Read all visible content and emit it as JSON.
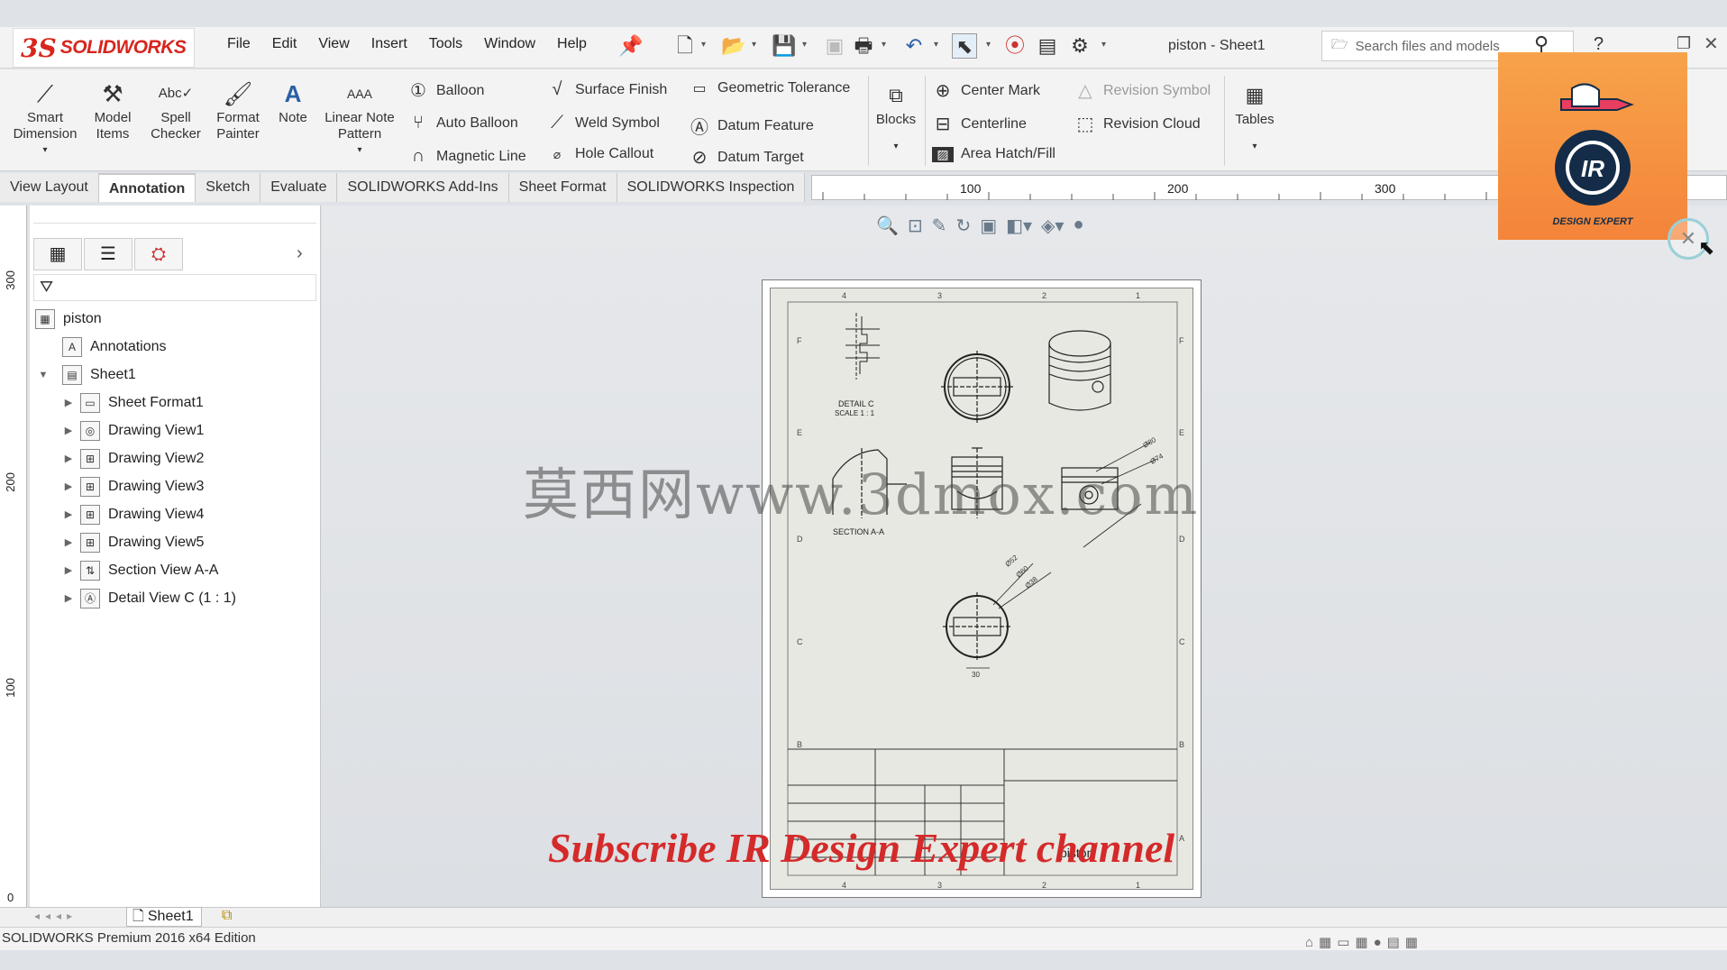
{
  "app": {
    "logo_ds": "3S",
    "logo_text": "SOLIDWORKS",
    "title": "piston - Sheet1",
    "status": "SOLIDWORKS Premium 2016 x64 Edition"
  },
  "menu": [
    "File",
    "Edit",
    "View",
    "Insert",
    "Tools",
    "Window",
    "Help"
  ],
  "search": {
    "placeholder": "Search files and models"
  },
  "ribbon": {
    "big": [
      {
        "label1": "Smart",
        "label2": "Dimension",
        "icon": "smart-dimension-icon"
      },
      {
        "label1": "Model",
        "label2": "Items",
        "icon": "model-items-icon"
      },
      {
        "label1": "Spell",
        "label2": "Checker",
        "icon": "spell-checker-icon"
      },
      {
        "label1": "Format",
        "label2": "Painter",
        "icon": "format-painter-icon"
      },
      {
        "label1": "Note",
        "label2": "",
        "icon": "note-icon"
      },
      {
        "label1": "Linear Note",
        "label2": "Pattern",
        "icon": "linear-note-pattern-icon"
      }
    ],
    "col1": [
      "Balloon",
      "Auto Balloon",
      "Magnetic Line"
    ],
    "col2": [
      "Surface Finish",
      "Weld Symbol",
      "Hole Callout"
    ],
    "col3": [
      "Geometric Tolerance",
      "Datum Feature",
      "Datum Target"
    ],
    "blocks": "Blocks",
    "col4": [
      "Center Mark",
      "Centerline",
      "Area Hatch/Fill"
    ],
    "col5": [
      "Revision Symbol",
      "Revision Cloud"
    ],
    "tables": "Tables"
  },
  "tabs": [
    "View Layout",
    "Annotation",
    "Sketch",
    "Evaluate",
    "SOLIDWORKS Add-Ins",
    "Sheet Format",
    "SOLIDWORKS Inspection"
  ],
  "active_tab": "Annotation",
  "ruler_top": [
    "100",
    "200",
    "300"
  ],
  "ruler_left": [
    "300",
    "200",
    "100",
    "0"
  ],
  "tree": {
    "root": "piston",
    "items": [
      {
        "label": "Annotations",
        "level": 1,
        "icon": "annotations-icon",
        "glyph": "A"
      },
      {
        "label": "Sheet1",
        "level": 1,
        "icon": "sheet-icon",
        "glyph": "▤",
        "expanded": true
      },
      {
        "label": "Sheet Format1",
        "level": 2,
        "icon": "sheet-format-icon",
        "glyph": "▭"
      },
      {
        "label": "Drawing View1",
        "level": 2,
        "icon": "drawing-view-icon",
        "glyph": "◎"
      },
      {
        "label": "Drawing View2",
        "level": 2,
        "icon": "drawing-view-icon",
        "glyph": "⊞"
      },
      {
        "label": "Drawing View3",
        "level": 2,
        "icon": "drawing-view-icon",
        "glyph": "⊞"
      },
      {
        "label": "Drawing View4",
        "level": 2,
        "icon": "drawing-view-icon",
        "glyph": "⊞"
      },
      {
        "label": "Drawing View5",
        "level": 2,
        "icon": "drawing-view-icon",
        "glyph": "⊞"
      },
      {
        "label": "Section View A-A",
        "level": 2,
        "icon": "section-view-icon",
        "glyph": "⇅"
      },
      {
        "label": "Detail View C (1 : 1)",
        "level": 2,
        "icon": "detail-view-icon",
        "glyph": "Ⓐ"
      }
    ]
  },
  "drawing": {
    "detail_label_1": "DETAIL C",
    "detail_label_2": "SCALE 1 : 1",
    "section_label": "SECTION A-A",
    "title_block_name": "piston",
    "zone_cols": [
      "4",
      "3",
      "2",
      "1"
    ],
    "zone_rows": [
      "F",
      "E",
      "D",
      "C",
      "B",
      "A"
    ],
    "dims": [
      "Ø80",
      "Ø74",
      "Ø52",
      "Ø60",
      "Ø38",
      "Ø18",
      "30"
    ]
  },
  "overlays": {
    "watermark": "莫西网www.3dmox.com",
    "subscribe": "Subscribe IR Design Expert channel",
    "badge": "DESIGN EXPERT",
    "badge_letters": "IR"
  },
  "bottom": {
    "sheet_tab": "Sheet1"
  }
}
